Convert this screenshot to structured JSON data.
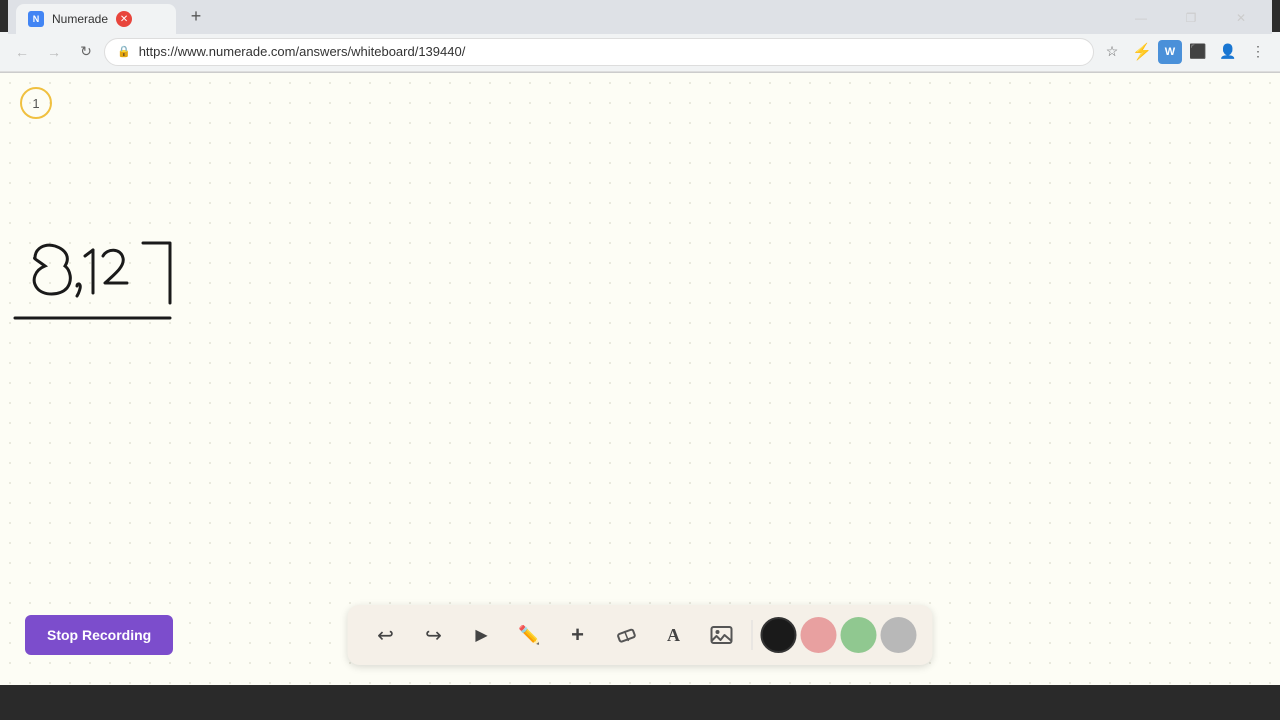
{
  "browser": {
    "tab_title": "Numerade",
    "url": "https://www.numerade.com/answers/whiteboard/139440/",
    "favicon_text": "N",
    "new_tab_label": "+",
    "win_minimize": "—",
    "win_restore": "❐",
    "win_close": "✕"
  },
  "nav": {
    "back_icon": "←",
    "forward_icon": "→",
    "reload_icon": "↻",
    "home_icon": "⌂",
    "lock_icon": "🔒",
    "bookmark_icon": "☆",
    "extensions_icon": "⚡",
    "wordtune_icon": "W",
    "screenshare_icon": "⬛",
    "profile_icon": "👤",
    "menu_icon": "⋮"
  },
  "whiteboard": {
    "page_number": "1",
    "handwriting_text": "8,12",
    "background_color": "#fdfdf5"
  },
  "toolbar": {
    "undo_icon": "↩",
    "redo_icon": "↪",
    "select_icon": "▶",
    "pen_icon": "✏",
    "add_icon": "+",
    "eraser_icon": "/",
    "text_icon": "A",
    "image_icon": "🖼",
    "colors": [
      {
        "name": "black",
        "hex": "#1a1a1a",
        "selected": true
      },
      {
        "name": "pink",
        "hex": "#e8a0a0",
        "selected": false
      },
      {
        "name": "green",
        "hex": "#90c890",
        "selected": false
      },
      {
        "name": "gray",
        "hex": "#b8b8b8",
        "selected": false
      }
    ]
  },
  "stop_recording": {
    "label": "Stop Recording",
    "bg_color": "#7c4dcc"
  }
}
